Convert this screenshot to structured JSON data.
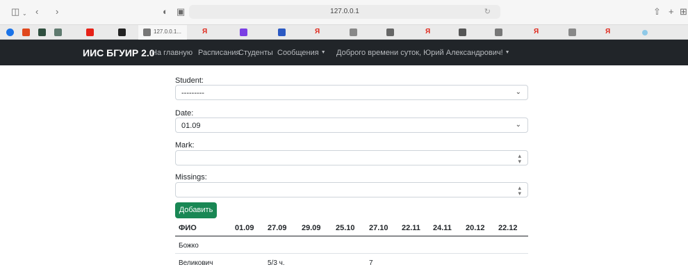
{
  "browser": {
    "url": "127.0.0.1",
    "active_tab_label": "127.0.0.1...",
    "tab_letters": [
      "Я",
      "Я",
      "Я",
      "Я",
      "Я"
    ]
  },
  "navbar": {
    "brand": "ИИС БГУИР 2.0",
    "links": [
      "На главную",
      "Расписания",
      "Студенты",
      "Сообщения",
      "Доброго времени суток, Юрий Александрович!"
    ]
  },
  "form": {
    "student": {
      "label": "Student:",
      "value": "---------"
    },
    "date": {
      "label": "Date:",
      "value": "01.09"
    },
    "mark": {
      "label": "Mark:",
      "value": ""
    },
    "missings": {
      "label": "Missings:",
      "value": ""
    },
    "submit_label": "Добавить"
  },
  "table": {
    "headers": [
      "ФИО",
      "01.09",
      "27.09",
      "29.09",
      "25.10",
      "27.10",
      "22.11",
      "24.11",
      "20.12",
      "22.12"
    ],
    "rows": [
      [
        "Божко",
        "",
        "",
        "",
        "",
        "",
        "",
        "",
        "",
        ""
      ],
      [
        "Великович",
        "",
        "5/3 ч.",
        "",
        "",
        "7",
        "",
        "",
        "",
        ""
      ]
    ]
  },
  "colors": {
    "navbar_bg": "#212529",
    "button_bg": "#198754"
  }
}
